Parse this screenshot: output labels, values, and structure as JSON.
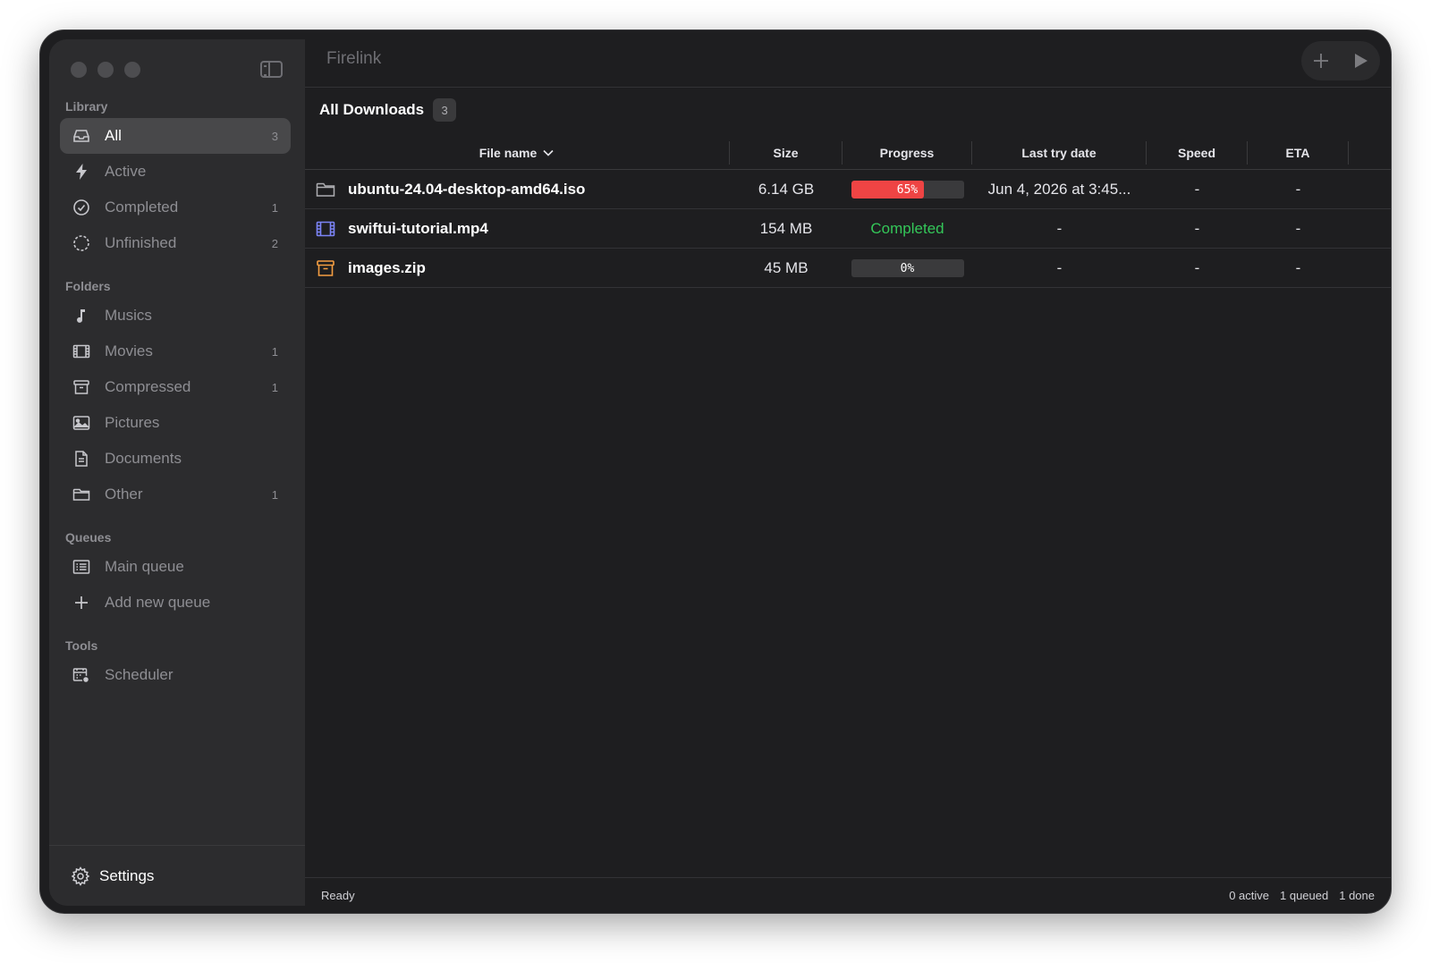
{
  "app": {
    "title": "Firelink"
  },
  "sidebar": {
    "sections": {
      "library": "Library",
      "folders": "Folders",
      "queues": "Queues",
      "tools": "Tools"
    },
    "library": [
      {
        "label": "All",
        "count": "3",
        "icon": "tray-icon"
      },
      {
        "label": "Active",
        "count": "",
        "icon": "bolt-icon"
      },
      {
        "label": "Completed",
        "count": "1",
        "icon": "check-circle-icon"
      },
      {
        "label": "Unfinished",
        "count": "2",
        "icon": "dashed-circle-icon"
      }
    ],
    "folders": [
      {
        "label": "Musics",
        "count": "",
        "icon": "music-note-icon"
      },
      {
        "label": "Movies",
        "count": "1",
        "icon": "film-icon"
      },
      {
        "label": "Compressed",
        "count": "1",
        "icon": "archive-box-icon"
      },
      {
        "label": "Pictures",
        "count": "",
        "icon": "photo-icon"
      },
      {
        "label": "Documents",
        "count": "",
        "icon": "document-icon"
      },
      {
        "label": "Other",
        "count": "1",
        "icon": "folder-icon"
      }
    ],
    "queues": [
      {
        "label": "Main queue",
        "icon": "list-icon"
      },
      {
        "label": "Add new queue",
        "icon": "plus-icon"
      }
    ],
    "tools": [
      {
        "label": "Scheduler",
        "icon": "calendar-clock-icon"
      }
    ],
    "settings": "Settings"
  },
  "main": {
    "section_title": "All Downloads",
    "section_count": "3",
    "columns": {
      "name": "File name",
      "size": "Size",
      "progress": "Progress",
      "last_try": "Last try date",
      "speed": "Speed",
      "eta": "ETA"
    },
    "rows": [
      {
        "name": "ubuntu-24.04-desktop-amd64.iso",
        "size": "6.14 GB",
        "progress_label": "65%",
        "progress": 65,
        "last_try": "Jun 4, 2026 at 3:45...",
        "speed": "-",
        "eta": "-",
        "icon": "folder-icon"
      },
      {
        "name": "swiftui-tutorial.mp4",
        "size": "154 MB",
        "status": "Completed",
        "last_try": "-",
        "speed": "-",
        "eta": "-",
        "icon": "film-icon"
      },
      {
        "name": "images.zip",
        "size": "45 MB",
        "progress_label": "0%",
        "progress": 0,
        "last_try": "-",
        "speed": "-",
        "eta": "-",
        "icon": "archive-box-icon"
      }
    ]
  },
  "status": {
    "left": "Ready",
    "active": "0 active",
    "queued": "1 queued",
    "done": "1 done"
  },
  "colors": {
    "progress_fill": "#ef4444",
    "completed": "#34c759",
    "movie_icon": "#7b83f5",
    "archive_icon": "#f59e42"
  }
}
